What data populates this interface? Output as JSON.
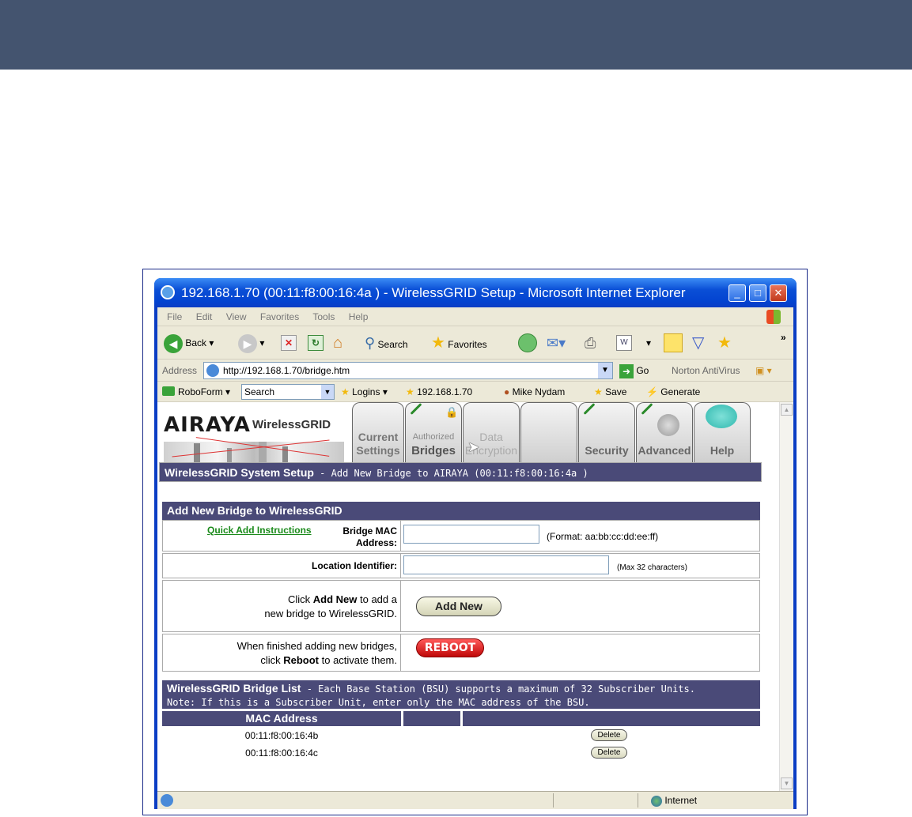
{
  "window": {
    "title": "192.168.1.70 (00:11:f8:00:16:4a ) - WirelessGRID Setup - Microsoft Internet Explorer"
  },
  "menu": [
    "File",
    "Edit",
    "View",
    "Favorites",
    "Tools",
    "Help"
  ],
  "toolbar": {
    "back_label": "Back",
    "search_label": "Search",
    "favorites_label": "Favorites"
  },
  "address": {
    "label": "Address",
    "url": "http://192.168.1.70/bridge.htm",
    "go_label": "Go",
    "norton_label": "Norton AntiVirus"
  },
  "links": {
    "roboform": "RoboForm",
    "search_value": "Search",
    "logins": "Logins",
    "ip": "192.168.1.70",
    "user": "Mike Nydam",
    "save": "Save",
    "generate": "Generate"
  },
  "logo": {
    "brand": "AIRAYA",
    "product": "WirelessGRID"
  },
  "tabs": {
    "current_line1": "Current",
    "current_line2": "Settings",
    "authorized_line1": "Authorized",
    "authorized_line2": "Bridges",
    "data_line1": "Data",
    "data_line2": "Encryption",
    "security": "Security",
    "advanced": "Advanced",
    "help": "Help"
  },
  "setup_header": {
    "title": "WirelessGRID System Setup",
    "subtitle": " - Add New Bridge to AIRAYA (00:11:f8:00:16:4a )"
  },
  "add_section": {
    "title": "Add New Bridge to WirelessGRID",
    "quick_add_link": "Quick Add Instructions",
    "mac_label_1": "Bridge MAC",
    "mac_label_2": "Address:",
    "mac_value": "",
    "mac_format": "(Format: aa:bb:cc:dd:ee:ff)",
    "location_label": "Location Identifier:",
    "location_value": "",
    "location_hint": "(Max 32 characters)",
    "addnew_pre": "Click ",
    "addnew_bold": "Add New",
    "addnew_post": " to add a",
    "addnew_line2": "new bridge to WirelessGRID.",
    "addnew_button": "Add New",
    "reboot_line1": "When finished adding new bridges,",
    "reboot_pre": "click ",
    "reboot_bold": "Reboot",
    "reboot_post": " to activate them.",
    "reboot_button": "REBOOT"
  },
  "bridge_list": {
    "title": "WirelessGRID Bridge List",
    "subtitle": " - Each Base Station (BSU) supports a maximum of 32 Subscriber Units.",
    "note": "Note: If this is a Subscriber Unit, enter only the MAC address of the BSU.",
    "col_mac": "MAC Address",
    "rows": [
      {
        "mac": "00:11:f8:00:16:4b",
        "action": "Delete"
      },
      {
        "mac": "00:11:f8:00:16:4c",
        "action": "Delete"
      }
    ]
  },
  "status": {
    "zone": "Internet"
  },
  "colors": {
    "topbar": "#44546f",
    "header": "#4a4a78",
    "link": "#1a8a1a",
    "reboot": "#d81c1c"
  }
}
